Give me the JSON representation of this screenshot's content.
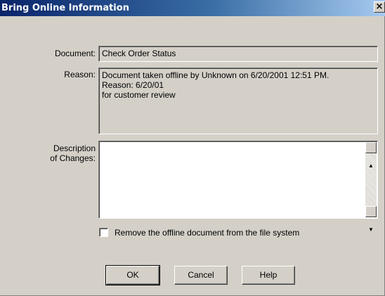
{
  "window": {
    "title": "Bring Online Information",
    "close_glyph": "×"
  },
  "form": {
    "document_label": "Document:",
    "document_value": "Check Order Status",
    "reason_label": "Reason:",
    "reason_value": "Document taken offline by Unknown on 6/20/2001 12:51 PM.\nReason: 6/20/01\nfor customer review",
    "description_label": "Description\nof Changes:",
    "description_value": "",
    "remove_checkbox_label": "Remove the offline document from the file system",
    "remove_checkbox_checked": false
  },
  "buttons": {
    "ok": "OK",
    "cancel": "Cancel",
    "help": "Help"
  },
  "icons": {
    "scroll_up": "up-arrow-icon",
    "scroll_down": "down-arrow-icon",
    "close": "close-icon"
  },
  "colors": {
    "title_gradient_start": "#0a246a",
    "title_gradient_end": "#a6caf0",
    "dialog_bg": "#d4d0c8"
  }
}
